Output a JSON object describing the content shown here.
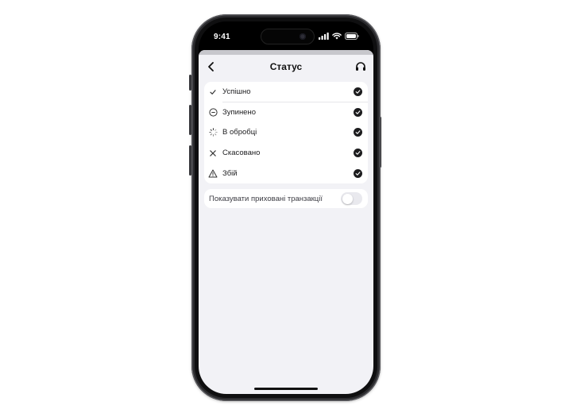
{
  "statusbar": {
    "time": "9:41"
  },
  "nav": {
    "title": "Статус",
    "back_icon": "chevron-left-icon",
    "support_icon": "headset-icon"
  },
  "statuses": [
    {
      "label": "Успішно",
      "icon": "checkmark-icon",
      "selected": true
    },
    {
      "label": "Зупинено",
      "icon": "minus-circle-icon",
      "selected": true
    },
    {
      "label": "В обробці",
      "icon": "spinner-icon",
      "selected": true
    },
    {
      "label": "Скасовано",
      "icon": "cross-icon",
      "selected": true
    },
    {
      "label": "Збій",
      "icon": "warning-triangle-icon",
      "selected": true
    }
  ],
  "hidden_toggle": {
    "label": "Показувати приховані транзакції",
    "on": false
  },
  "colors": {
    "sheet_background": "#f2f2f6",
    "card_background": "#ffffff",
    "check_fill": "#1c1c1e",
    "toggle_off": "#e9e9ee"
  }
}
